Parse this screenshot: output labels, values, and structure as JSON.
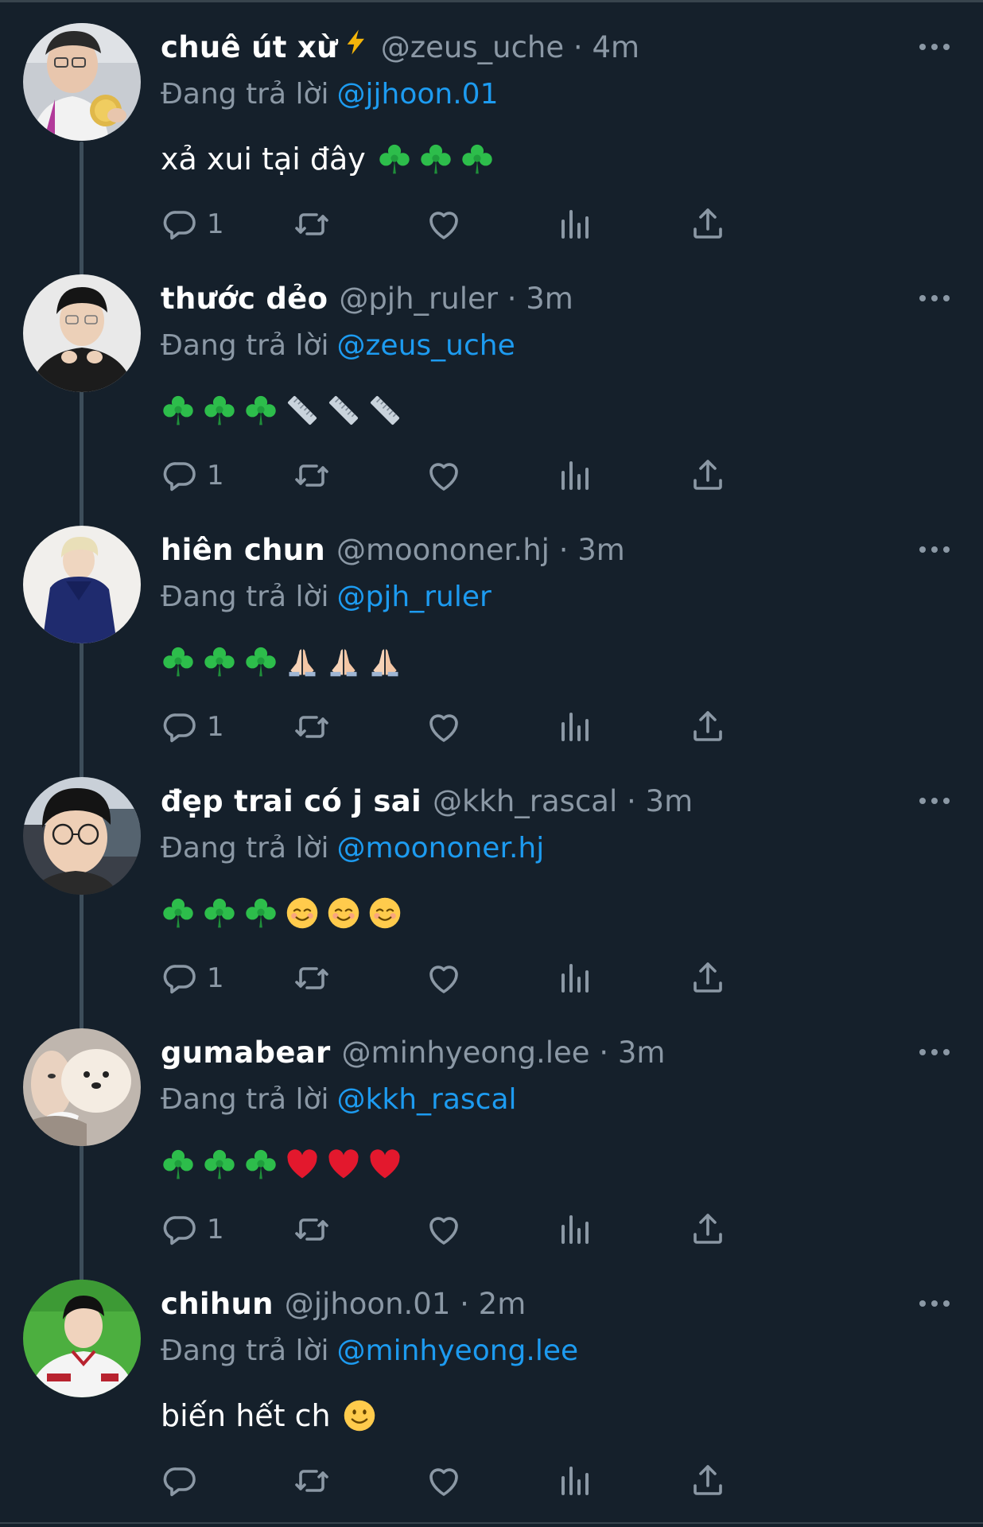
{
  "reply_prefix": "Đang trả lời",
  "colors": {
    "background": "#15202b",
    "muted": "#8b98a5",
    "link": "#1d9bf0",
    "divider": "#38444d"
  },
  "tweets": [
    {
      "name": "chuê út xừ",
      "badge": "lightning-emoji",
      "handle": "@zeus_uche",
      "time": "4m",
      "reply_to": "@jjhoon.01",
      "text": "xả xui tại đây",
      "emojis": [
        "shamrock",
        "shamrock",
        "shamrock"
      ],
      "reply_count": "1",
      "avatar": "avatar-gold-medal"
    },
    {
      "name": "thước dẻo",
      "handle": "@pjh_ruler",
      "time": "3m",
      "reply_to": "@zeus_uche",
      "text": "",
      "emojis": [
        "shamrock",
        "shamrock",
        "shamrock",
        "ruler",
        "ruler",
        "ruler"
      ],
      "reply_count": "1",
      "avatar": "avatar-black-hoodie"
    },
    {
      "name": "hiên chun",
      "handle": "@moononer.hj",
      "time": "3m",
      "reply_to": "@pjh_ruler",
      "text": "",
      "emojis": [
        "shamrock",
        "shamrock",
        "shamrock",
        "folded-hands",
        "folded-hands",
        "folded-hands"
      ],
      "reply_count": "1",
      "avatar": "avatar-blonde-blue-jacket"
    },
    {
      "name": "đẹp trai có j sai",
      "handle": "@kkh_rascal",
      "time": "3m",
      "reply_to": "@moononer.hj",
      "text": "",
      "emojis": [
        "shamrock",
        "shamrock",
        "shamrock",
        "smiling-face",
        "smiling-face",
        "smiling-face"
      ],
      "reply_count": "1",
      "avatar": "avatar-glasses-selfie"
    },
    {
      "name": "gumabear",
      "handle": "@minhyeong.lee",
      "time": "3m",
      "reply_to": "@kkh_rascal",
      "text": "",
      "emojis": [
        "shamrock",
        "shamrock",
        "shamrock",
        "red-heart",
        "red-heart",
        "red-heart"
      ],
      "reply_count": "1",
      "avatar": "avatar-dog"
    },
    {
      "name": "chihun",
      "handle": "@jjhoon.01",
      "time": "2m",
      "reply_to": "@minhyeong.lee",
      "text": "biến hết ch",
      "emojis": [
        "slightly-smiling-face"
      ],
      "reply_count": "",
      "avatar": "avatar-baseball-uniform"
    }
  ]
}
